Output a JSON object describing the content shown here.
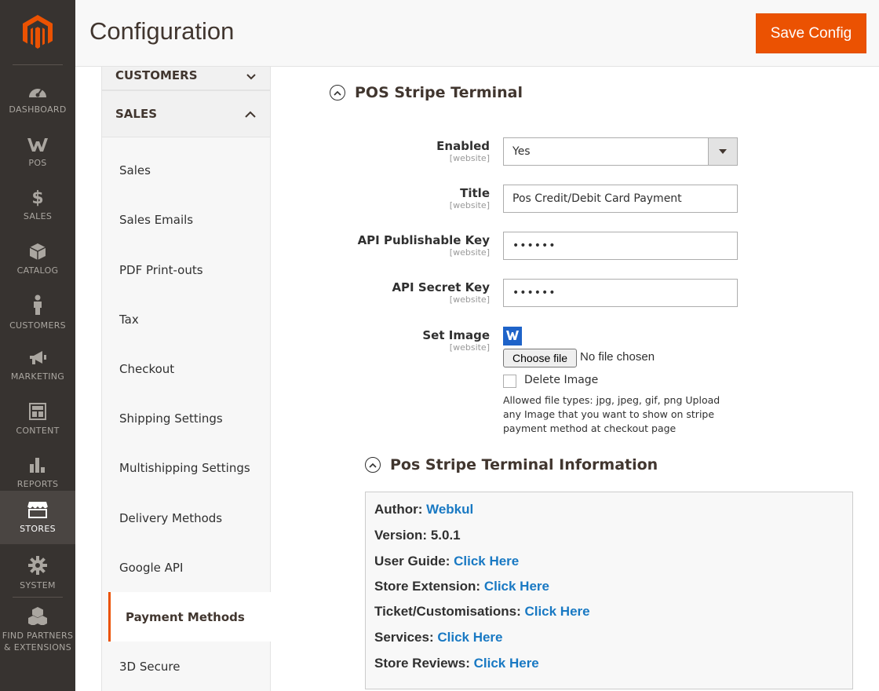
{
  "page": {
    "title": "Configuration",
    "save_label": "Save Config"
  },
  "menu": {
    "items": [
      {
        "label": "DASHBOARD",
        "icon": "dashboard-icon"
      },
      {
        "label": "POS",
        "icon": "pos-icon"
      },
      {
        "label": "SALES",
        "icon": "dollar-icon"
      },
      {
        "label": "CATALOG",
        "icon": "box-icon"
      },
      {
        "label": "CUSTOMERS",
        "icon": "person-icon"
      },
      {
        "label": "MARKETING",
        "icon": "megaphone-icon"
      },
      {
        "label": "CONTENT",
        "icon": "content-icon"
      },
      {
        "label": "REPORTS",
        "icon": "bar-chart-icon"
      },
      {
        "label": "STORES",
        "icon": "store-icon"
      },
      {
        "label": "SYSTEM",
        "icon": "gear-icon"
      },
      {
        "label": "FIND PARTNERS & EXTENSIONS",
        "icon": "cubes-icon"
      }
    ],
    "active": "STORES"
  },
  "tabs": {
    "customers_head": "CUSTOMERS",
    "sales_head": "SALES",
    "items": [
      "Sales",
      "Sales Emails",
      "PDF Print-outs",
      "Tax",
      "Checkout",
      "Shipping Settings",
      "Multishipping Settings",
      "Delivery Methods",
      "Google API",
      "Payment Methods",
      "3D Secure"
    ],
    "active": "Payment Methods"
  },
  "section": {
    "title": "POS Stripe Terminal",
    "fields": {
      "enabled": {
        "label": "Enabled",
        "scope": "[website]",
        "value": "Yes"
      },
      "title": {
        "label": "Title",
        "scope": "[website]",
        "value": "Pos Credit/Debit Card Payment"
      },
      "pub_key": {
        "label": "API Publishable Key",
        "scope": "[website]",
        "value": "••••••"
      },
      "secret_key": {
        "label": "API Secret Key",
        "scope": "[website]",
        "value": "••••••"
      },
      "image": {
        "label": "Set Image",
        "scope": "[website]",
        "choose_label": "Choose file",
        "no_file": "No file chosen",
        "delete_label": "Delete Image",
        "note": "Allowed file types: jpg, jpeg, gif, png Upload any Image that you want to show on stripe payment method at checkout page"
      }
    }
  },
  "info": {
    "title": "Pos Stripe Terminal Information",
    "lines": [
      {
        "label": "Author: ",
        "value": "Webkul",
        "link": true
      },
      {
        "label": "Version: ",
        "value": "5.0.1",
        "link": false
      },
      {
        "label": "User Guide: ",
        "value": "Click Here",
        "link": true
      },
      {
        "label": "Store Extension: ",
        "value": "Click Here",
        "link": true
      },
      {
        "label": "Ticket/Customisations: ",
        "value": "Click Here",
        "link": true
      },
      {
        "label": "Services: ",
        "value": "Click Here",
        "link": true
      },
      {
        "label": "Store Reviews: ",
        "value": "Click Here",
        "link": true
      }
    ]
  },
  "colors": {
    "accent": "#eb5202",
    "link": "#1979c3",
    "menu_bg": "#373330"
  }
}
